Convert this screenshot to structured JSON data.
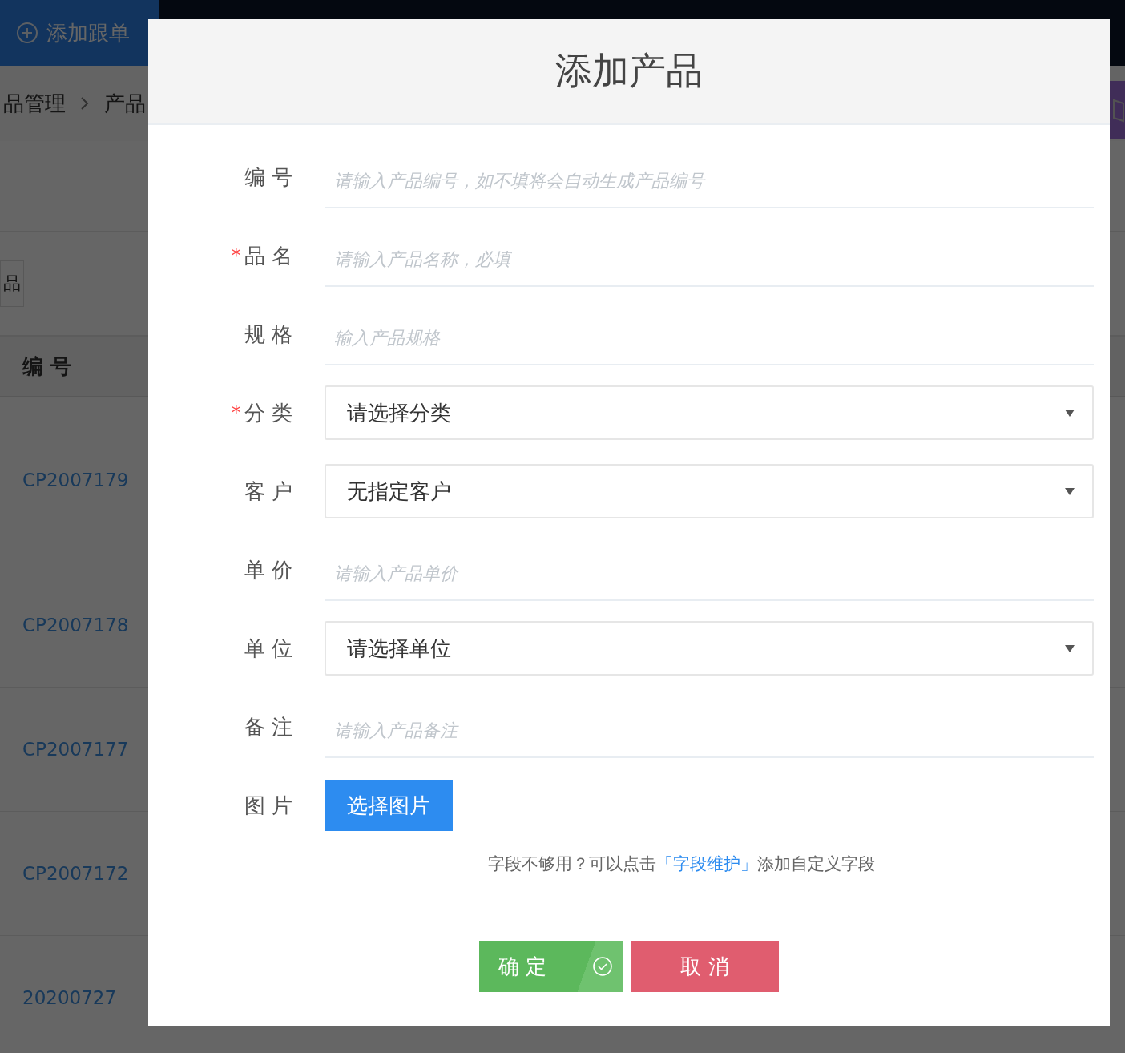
{
  "background": {
    "add_button": "添加跟单",
    "breadcrumb": [
      "品管理",
      "产品"
    ],
    "filter_button": "品",
    "table": {
      "columns": [
        "编 号"
      ],
      "rows": [
        "CP2007179",
        "CP2007178",
        "CP2007177",
        "CP2007172",
        "20200727"
      ]
    }
  },
  "dialog": {
    "title": "添加产品",
    "required_mark": "*",
    "fields": [
      {
        "label": "编 号",
        "kind": "input",
        "required": false,
        "placeholder": "请输入产品编号，如不填将会自动生成产品编号"
      },
      {
        "label": "品 名",
        "kind": "input",
        "required": true,
        "placeholder": "请输入产品名称，必填"
      },
      {
        "label": "规 格",
        "kind": "input",
        "required": false,
        "placeholder": "输入产品规格"
      },
      {
        "label": "分 类",
        "kind": "select",
        "required": true,
        "value": "请选择分类"
      },
      {
        "label": "客 户",
        "kind": "select",
        "required": false,
        "value": "无指定客户"
      },
      {
        "label": "单 价",
        "kind": "input",
        "required": false,
        "placeholder": "请输入产品单价"
      },
      {
        "label": "单 位",
        "kind": "select",
        "required": false,
        "value": "请选择单位"
      },
      {
        "label": "备 注",
        "kind": "input",
        "required": false,
        "placeholder": "请输入产品备注"
      },
      {
        "label": "图 片",
        "kind": "upload",
        "required": false,
        "button": "选择图片"
      }
    ],
    "hint": {
      "before": "字段不够用？可以点击",
      "link": "「字段维护」",
      "after": "添加自定义字段"
    },
    "buttons": [
      {
        "label": "确 定",
        "kind": "confirm"
      },
      {
        "label": "取 消",
        "kind": "cancel"
      }
    ]
  }
}
